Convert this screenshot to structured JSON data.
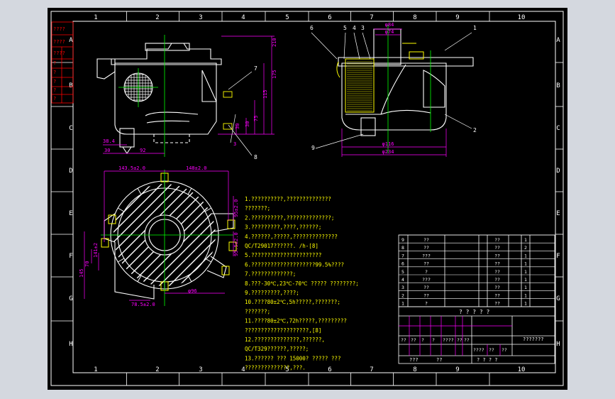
{
  "frame": {
    "col_labels": [
      "1",
      "2",
      "3",
      "4",
      "5",
      "6",
      "7",
      "8",
      "9",
      "10"
    ],
    "row_labels": [
      "A",
      "B",
      "C",
      "D",
      "E",
      "F",
      "G",
      "H"
    ],
    "left_stamp": [
      "????",
      "????",
      "????",
      "?",
      "?",
      "?",
      "?",
      "?"
    ]
  },
  "colors": {
    "background": "#000000",
    "frame": "#ffffff",
    "geometry": "#ffffff",
    "centerline": "#00ff00",
    "dimension": "#ff00ff",
    "notes": "#ffff00",
    "hatch": "#ffffff"
  },
  "front_view": {
    "dims": [
      "38.4",
      "30",
      "92",
      "175",
      "210",
      "115",
      "75",
      "30",
      "30",
      "3"
    ],
    "balloons": [
      "7",
      "8"
    ]
  },
  "side_view": {
    "dims": [
      "φ84",
      "φ74",
      "φ116",
      "φ234"
    ],
    "balloons": [
      "6",
      "5",
      "4",
      "3",
      "1",
      "2",
      "9"
    ]
  },
  "plan_view": {
    "dims": [
      "143.5±2.0",
      "148±2.0",
      "95±2.0",
      "95.5±2.0",
      "145",
      "70",
      "141±2",
      "φ96",
      "78.5±2.0"
    ]
  },
  "notes": {
    "lines": [
      "1.??????????,??????????????",
      "???????;",
      "2.??????????,??????????????;",
      "3.?????????,????,??????;",
      "4.??????,?????,??????????????",
      "QC/T29017??????.   /h-[8]",
      "5.??????????????????????",
      "6.????????????????????99.5%????",
      "7.?????????????;",
      "8.???-30℃,23℃-70℃ ????? ????????;",
      "9.?????????,????;",
      "10.????80±2℃,5h?????,???????;",
      "???????;",
      "11.????80±2℃,72h?????,?????????",
      "????????????????????,[8]",
      "12.??????????????,??????,",
      "QC/T329??????,?????;",
      "13.?????? ??? 15000? ????? ???",
      "??????????????,???."
    ]
  },
  "bom_table": {
    "rows": [
      {
        "no": "9",
        "name": "??",
        "spec": "??",
        "qty": "1"
      },
      {
        "no": "8",
        "name": "??",
        "spec": "??",
        "qty": "2"
      },
      {
        "no": "7",
        "name": "???",
        "spec": "??",
        "qty": "1"
      },
      {
        "no": "6",
        "name": "??",
        "spec": "??",
        "qty": "1"
      },
      {
        "no": "5",
        "name": "?",
        "spec": "??",
        "qty": "1"
      },
      {
        "no": "4",
        "name": "???",
        "spec": "??",
        "qty": "1"
      },
      {
        "no": "3",
        "name": "??",
        "spec": "??",
        "qty": "1"
      },
      {
        "no": "2",
        "name": "??",
        "spec": "??",
        "qty": "1"
      },
      {
        "no": "1",
        "name": "?",
        "spec": "??",
        "qty": "1"
      }
    ]
  },
  "title_block": {
    "title": "? ? ? ? ?",
    "drawing_no": "???????",
    "labels": [
      "??",
      "??",
      "?",
      "?",
      "????",
      "??",
      "??"
    ],
    "scale_labels": [
      "????",
      "??",
      "??"
    ],
    "bottom_left": "???",
    "bottom_mid": "??",
    "bottom_right": "? ? ? ?"
  }
}
